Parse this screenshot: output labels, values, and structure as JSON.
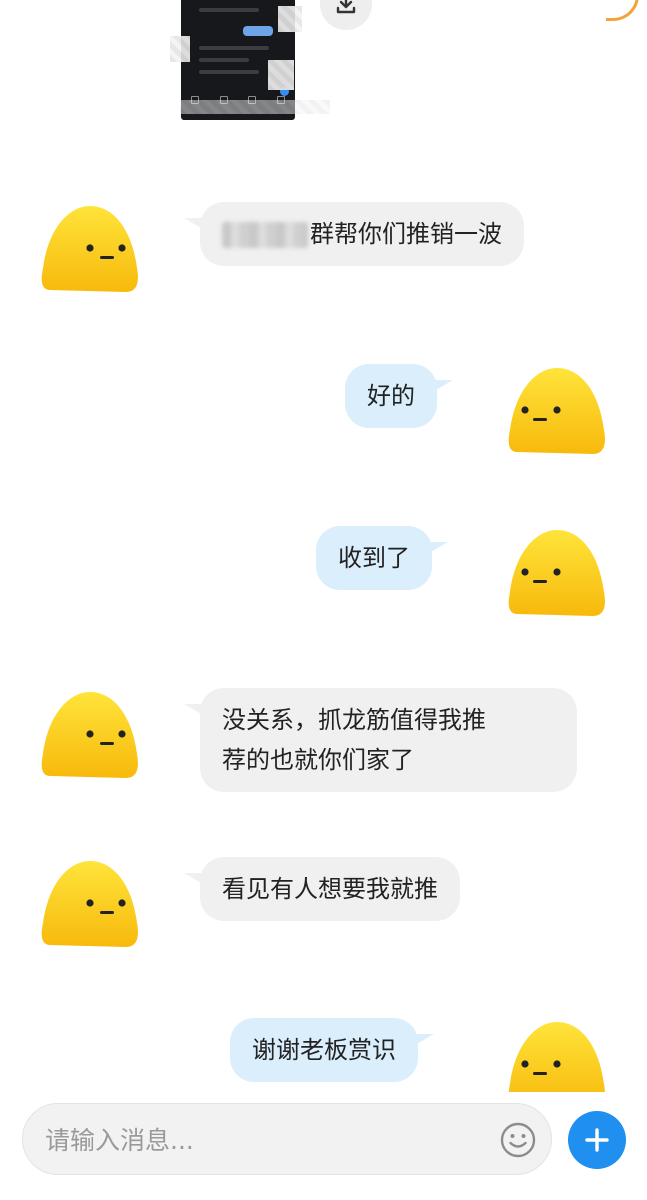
{
  "messages": [
    {
      "side": "in",
      "text": "群帮你们推销一波",
      "redacted_prefix": true
    },
    {
      "side": "out",
      "text": "好的"
    },
    {
      "side": "out",
      "text": "收到了"
    },
    {
      "side": "in",
      "lines": [
        "没关系，抓龙筋值得我推",
        "荐的也就你们家了"
      ]
    },
    {
      "side": "in",
      "text": "看见有人想要我就推"
    },
    {
      "side": "out",
      "text": "谢谢老板赏识"
    }
  ],
  "input": {
    "placeholder": "请输入消息..."
  },
  "icons": {
    "download": "download-icon",
    "emoji": "smiley-icon",
    "plus": "plus-icon",
    "avatar": "yellow-blob-avatar"
  },
  "colors": {
    "incoming_bubble": "#f0f0f0",
    "outgoing_bubble": "#dbeefc",
    "avatar_yellow": "#ffd21a",
    "send_blue": "#1f8ff0"
  }
}
